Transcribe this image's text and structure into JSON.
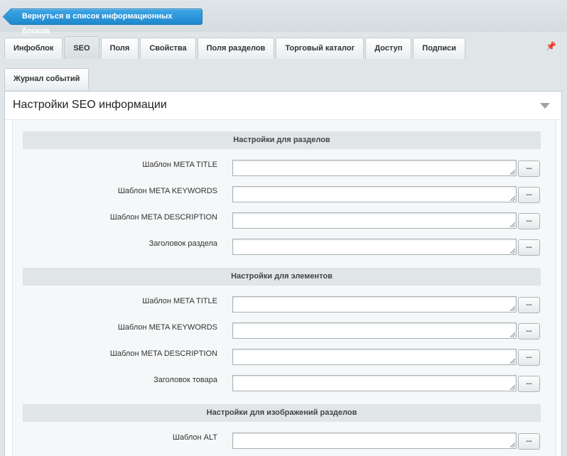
{
  "back_button": {
    "label": "Вернуться в список информационных блоков"
  },
  "tabs_row1": [
    {
      "label": "Инфоблок",
      "active": false
    },
    {
      "label": "SEO",
      "active": true
    },
    {
      "label": "Поля",
      "active": false
    },
    {
      "label": "Свойства",
      "active": false
    },
    {
      "label": "Поля разделов",
      "active": false
    },
    {
      "label": "Торговый каталог",
      "active": false
    },
    {
      "label": "Доступ",
      "active": false
    },
    {
      "label": "Подписи",
      "active": false
    }
  ],
  "tabs_row2": [
    {
      "label": "Журнал событий",
      "active": false
    }
  ],
  "panel": {
    "title": "Настройки SEO информации",
    "sections": [
      {
        "header": "Настройки для разделов",
        "fields": [
          {
            "label": "Шаблон META TITLE",
            "value": ""
          },
          {
            "label": "Шаблон META KEYWORDS",
            "value": ""
          },
          {
            "label": "Шаблон META DESCRIPTION",
            "value": ""
          },
          {
            "label": "Заголовок раздела",
            "value": ""
          }
        ]
      },
      {
        "header": "Настройки для элементов",
        "fields": [
          {
            "label": "Шаблон META TITLE",
            "value": ""
          },
          {
            "label": "Шаблон META KEYWORDS",
            "value": ""
          },
          {
            "label": "Шаблон META DESCRIPTION",
            "value": ""
          },
          {
            "label": "Заголовок товара",
            "value": ""
          }
        ]
      },
      {
        "header": "Настройки для изображений разделов",
        "fields": [
          {
            "label": "Шаблон ALT",
            "value": ""
          }
        ]
      }
    ]
  },
  "field_button_label": "...",
  "icons": {
    "pin": "pin-icon",
    "collapse": "chevron-down-icon"
  },
  "colors": {
    "accent": "#1f88cd",
    "section_bg": "#e0e5e7",
    "page_bg": "#e0e6e8"
  }
}
